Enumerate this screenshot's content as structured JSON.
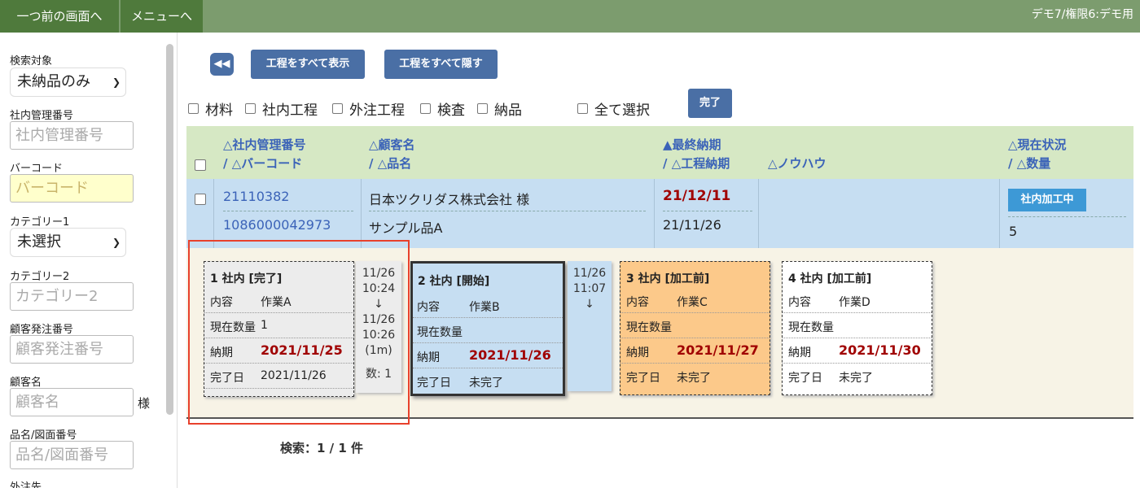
{
  "topbar": {
    "back": "一つ前の画面へ",
    "menu": "メニューへ",
    "user": "デモ7/権限6:デモ用"
  },
  "sidebar": {
    "search_target_label": "検索対象",
    "search_target_value": "未納品のみ",
    "mgmt_label": "社内管理番号",
    "mgmt_placeholder": "社内管理番号",
    "barcode_label": "バーコード",
    "barcode_placeholder": "バーコード",
    "cat1_label": "カテゴリー1",
    "cat1_value": "未選択",
    "cat2_label": "カテゴリー2",
    "cat2_placeholder": "カテゴリー2",
    "order_label": "顧客発注番号",
    "order_placeholder": "顧客発注番号",
    "customer_label": "顧客名",
    "customer_placeholder": "顧客名",
    "customer_suffix": "様",
    "product_label": "品名/図面番号",
    "product_placeholder": "品名/図面番号",
    "outsource_label": "外注先"
  },
  "toolbar": {
    "rewind_icon": "◀◀",
    "show_all": "工程をすべて表示",
    "hide_all": "工程をすべて隠す",
    "complete": "完了"
  },
  "filters": {
    "material": "材料",
    "internal": "社内工程",
    "external": "外注工程",
    "inspect": "検査",
    "delivery": "納品",
    "select_all": "全て選択"
  },
  "table": {
    "headers": {
      "h1a": "△社内管理番号",
      "h1b": "/ △バーコード",
      "h2a": "△顧客名",
      "h2b": "/ △品名",
      "h3a": "▲最終納期",
      "h3b": "/ △工程納期",
      "h4": "△ノウハウ",
      "h5a": "△現在状況",
      "h5b": "/ △数量"
    },
    "row": {
      "mgmt_no": "21110382",
      "barcode": "1086000042973",
      "customer": "日本ツクリダス株式会社 様",
      "product": "サンプル品A",
      "final_due": "21/12/11",
      "proc_due": "21/11/26",
      "status": "社内加工中",
      "qty": "5"
    }
  },
  "process": {
    "labels": {
      "content": "内容",
      "qty": "現在数量",
      "due": "納期",
      "done": "完了日"
    },
    "cards": [
      {
        "title": "1 社内 [完了]",
        "content": "作業A",
        "qty": "1",
        "due": "2021/11/25",
        "done": "2021/11/26"
      },
      {
        "title": "2 社内 [開始]",
        "content": "作業B",
        "qty": "",
        "due": "2021/11/26",
        "done": "未完了"
      },
      {
        "title": "3 社内 [加工前]",
        "content": "作業C",
        "qty": "",
        "due": "2021/11/27",
        "done": "未完了"
      },
      {
        "title": "4 社内 [加工前]",
        "content": "作業D",
        "qty": "",
        "due": "2021/11/30",
        "done": "未完了"
      }
    ],
    "conn1": {
      "l1": "11/26",
      "l2": "10:24",
      "arrow": "↓",
      "l3": "11/26",
      "l4": "10:26",
      "l5": "(1m)",
      "l6": "数: 1"
    },
    "conn2": {
      "l1": "11/26",
      "l2": "11:07",
      "arrow": "↓"
    }
  },
  "result_count": "検索：1 / 1 件",
  "colors": {
    "accent": "#4a6fa5",
    "topbar": "#7c9c6e",
    "red": "#a00000"
  }
}
